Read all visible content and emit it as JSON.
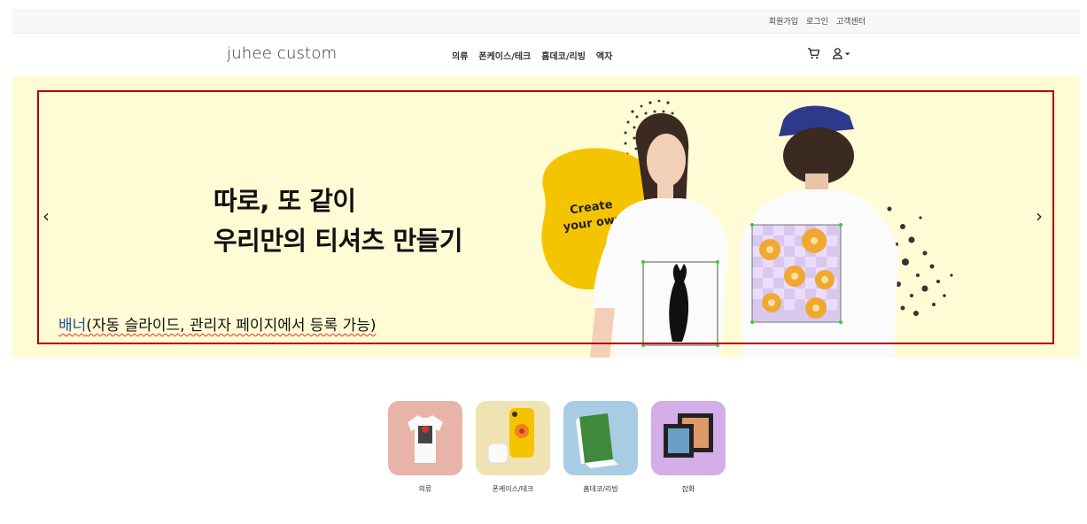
{
  "top_links": [
    "회원가입",
    "로그인",
    "고객센터"
  ],
  "logo": "juhee custom",
  "nav": [
    "의류",
    "폰케이스/테크",
    "홈데코/리빙",
    "액자"
  ],
  "banner": {
    "headline_line1": "따로, 또 같이",
    "headline_line2": "우리만의 티셔츠 만들기",
    "badge_text_1": "Create",
    "badge_text_2": "your own!",
    "note_part1": "배너",
    "note_part2": "(자동 슬라이드, 관리자 페이지에서 등록 가능)",
    "prev_arrow": "‹",
    "next_arrow": "›"
  },
  "categories": [
    {
      "label": "의류",
      "color": "#e8b3a8"
    },
    {
      "label": "폰케이스/테크",
      "color": "#efe3b3"
    },
    {
      "label": "홈데코/리빙",
      "color": "#a9cce5"
    },
    {
      "label": "잡화",
      "color": "#d3aee8"
    }
  ],
  "colors": {
    "banner_bg": "#fffbd4",
    "frame": "#b00000",
    "badge": "#f5c400"
  }
}
